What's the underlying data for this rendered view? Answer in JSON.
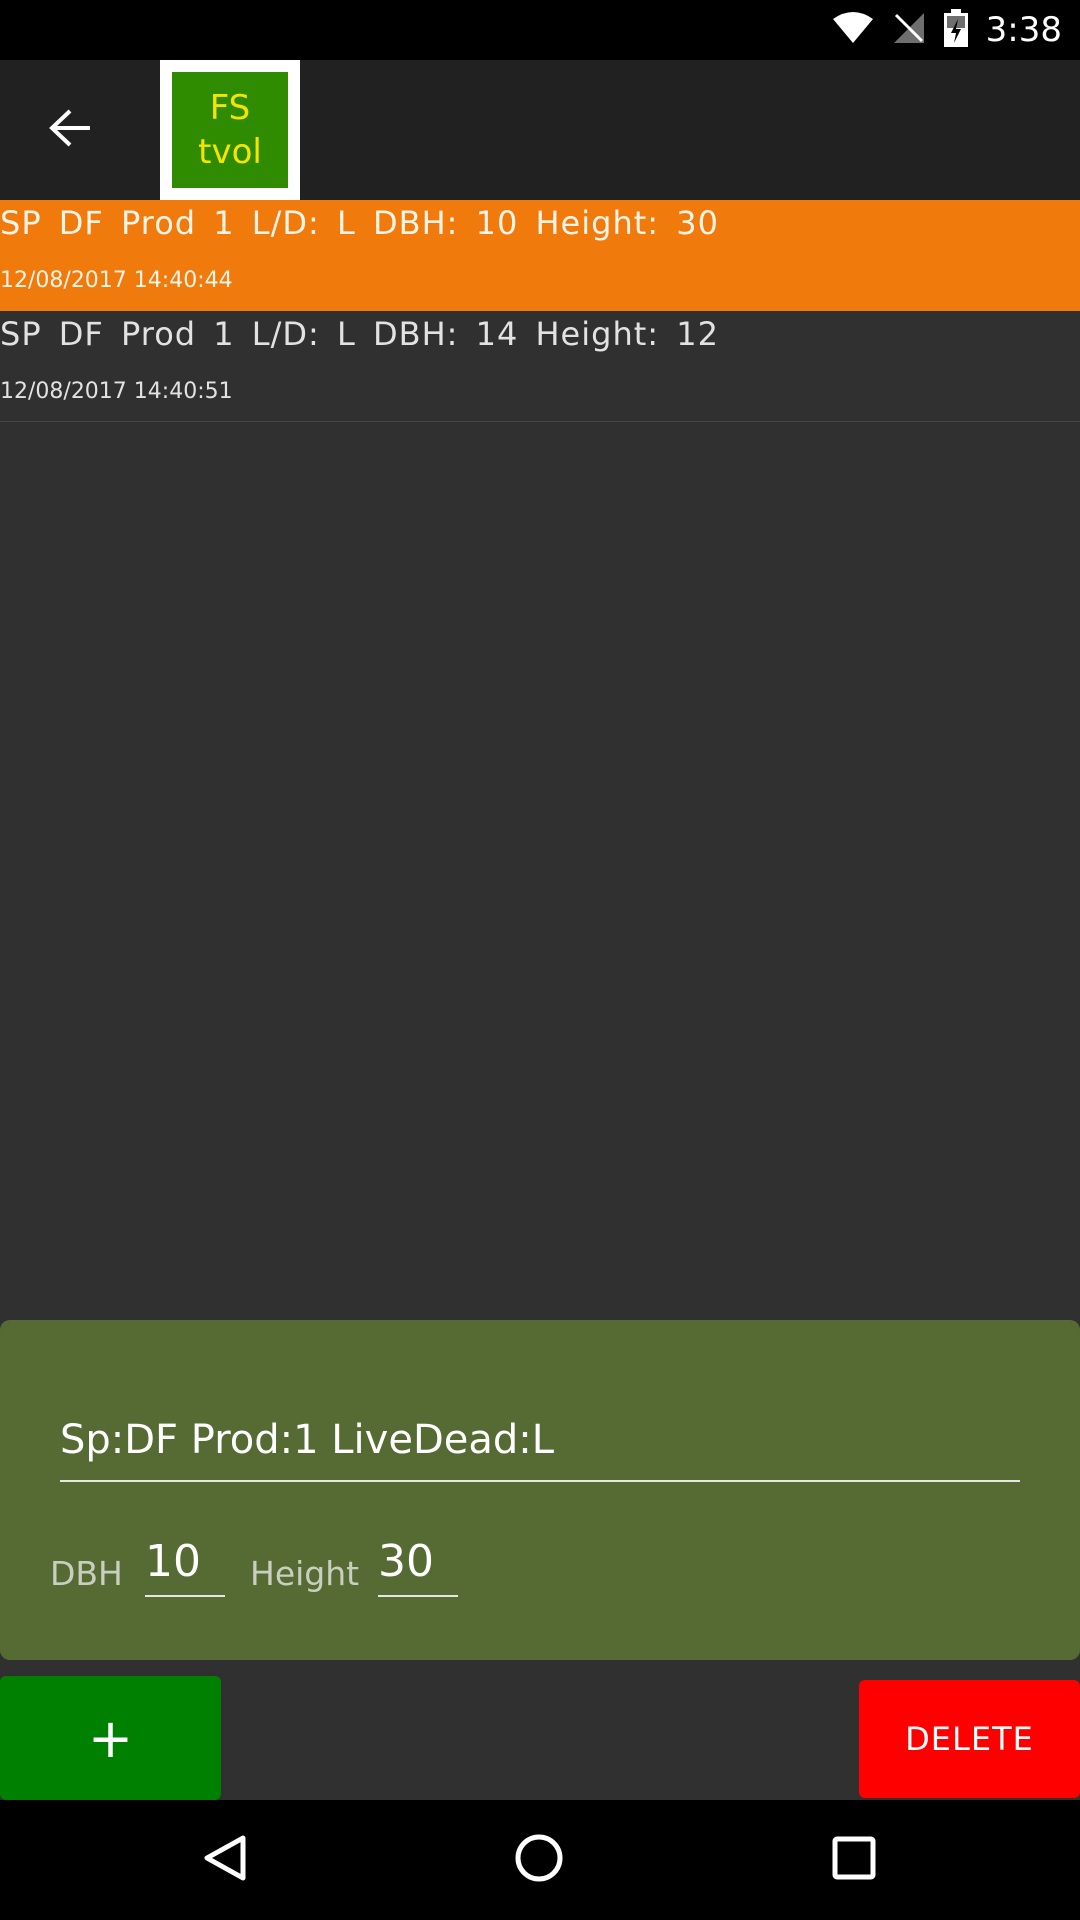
{
  "status_bar": {
    "time": "3:38",
    "icons": [
      "wifi-icon",
      "no-signal-icon",
      "battery-charging-icon"
    ]
  },
  "toolbar": {
    "back_icon": "arrow-left-icon",
    "logo_line1": "FS",
    "logo_line2": "tvol"
  },
  "records": [
    {
      "summary": "SP DF Prod 1 L/D: L DBH: 10 Height: 30",
      "timestamp": "12/08/2017 14:40:44",
      "selected": true
    },
    {
      "summary": "SP DF Prod 1 L/D: L DBH: 14 Height: 12",
      "timestamp": "12/08/2017 14:40:51",
      "selected": false
    }
  ],
  "edit_panel": {
    "description": "Sp:DF Prod:1 LiveDead:L",
    "dbh_label": "DBH",
    "dbh_value": "10",
    "height_label": "Height",
    "height_value": "30"
  },
  "buttons": {
    "add_label": "+",
    "delete_label": "DELETE"
  },
  "colors": {
    "selected_row": "#f07a0c",
    "edit_panel": "#566b33",
    "add_button": "#008000",
    "delete_button": "#ff0000",
    "logo_bg": "#2f8c00",
    "logo_text": "#f6e400"
  },
  "nav_bar": {
    "icons": [
      "back-triangle-icon",
      "home-circle-icon",
      "recents-square-icon"
    ]
  }
}
